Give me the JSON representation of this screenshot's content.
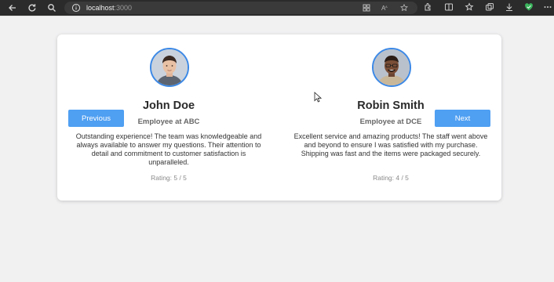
{
  "browser": {
    "url_host": "localhost",
    "url_port": ":3000"
  },
  "testimonials": [
    {
      "name": "John Doe",
      "role": "Employee at ABC",
      "quote": "Outstanding experience! The team was knowledgeable and always available to answer my questions. Their attention to detail and commitment to customer satisfaction is unparalleled.",
      "rating": "Rating: 5 / 5"
    },
    {
      "name": "Robin Smith",
      "role": "Employee at DCE",
      "quote": "Excellent service and amazing products! The staff went above and beyond to ensure I was satisfied with my purchase. Shipping was fast and the items were packaged securely.",
      "rating": "Rating: 4 / 5"
    }
  ],
  "buttons": {
    "previous": "Previous",
    "next": "Next"
  },
  "colors": {
    "accent": "#4f9ff2",
    "avatar_ring": "#3b88e6"
  }
}
